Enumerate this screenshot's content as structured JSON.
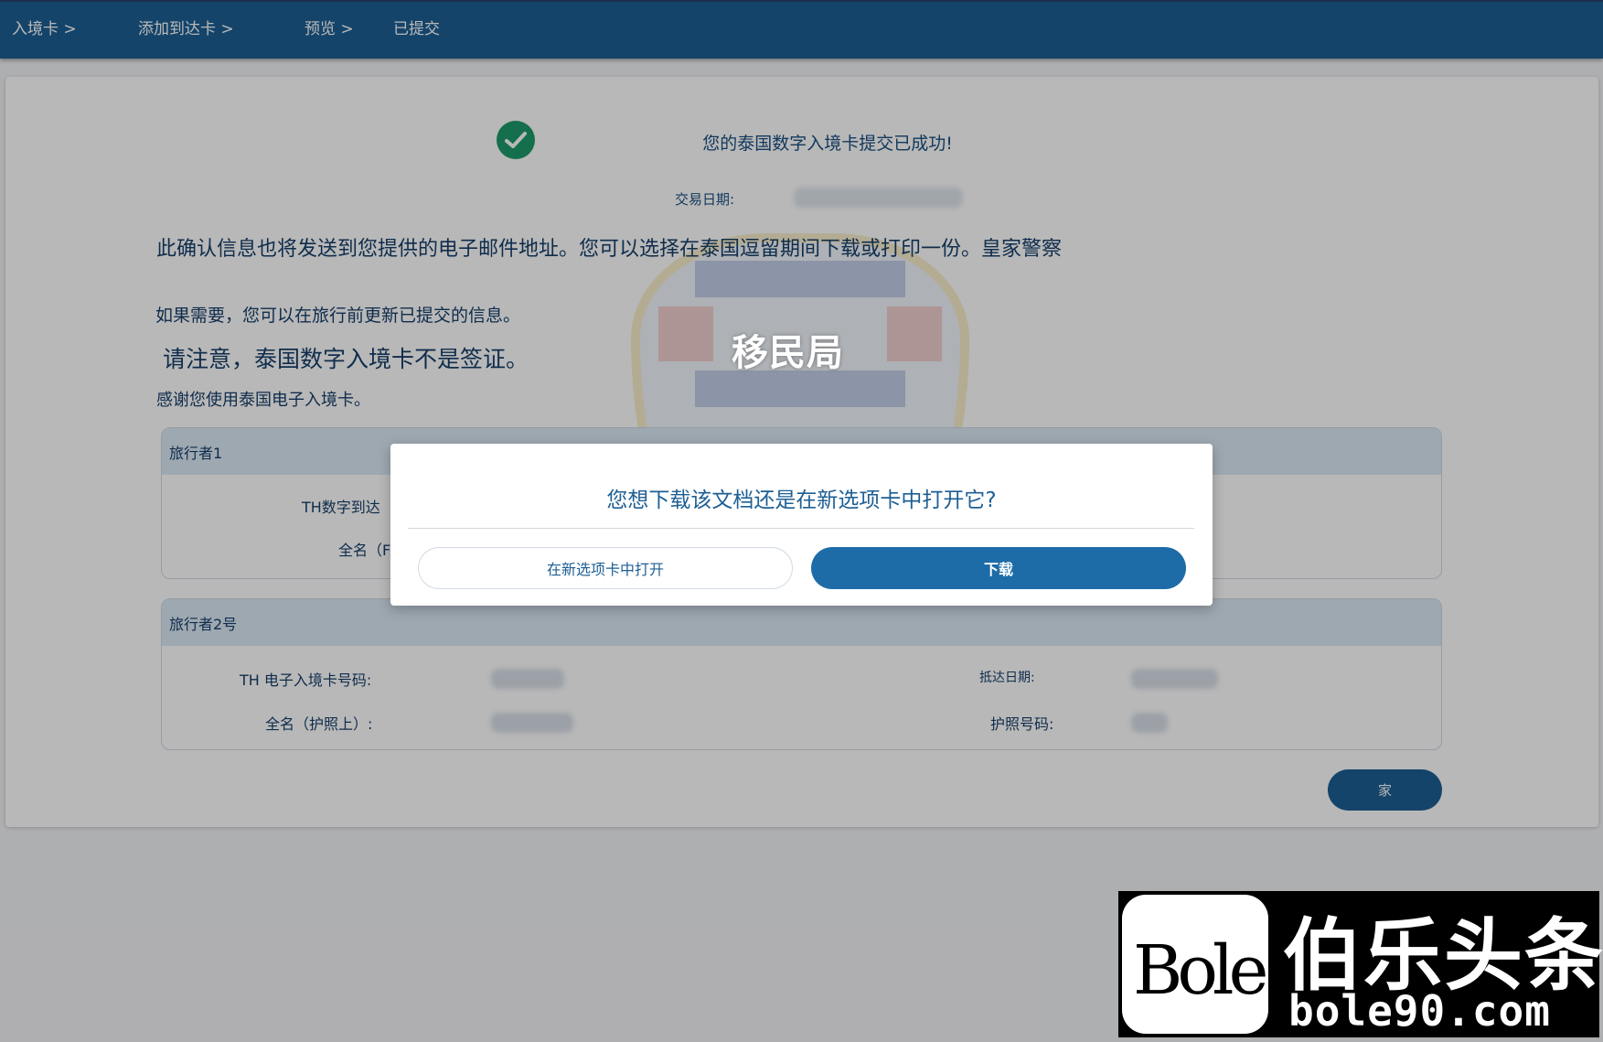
{
  "nav": {
    "steps": [
      "入境卡 >",
      "添加到达卡 >",
      "预览 >",
      "已提交"
    ]
  },
  "confirmation": {
    "title": "您的泰国数字入境卡提交已成功!",
    "transaction_label": "交易日期:",
    "message_email": "此确认信息也将发送到您提供的电子邮件地址。您可以选择在泰国逗留期间下载或打印一份。皇家警察",
    "message_update": "如果需要，您可以在旅行前更新已提交的信息。",
    "message_visa": "请注意，泰国数字入境卡不是签证。",
    "message_thanks": "感谢您使用泰国电子入境卡。",
    "overlay_text": "移民局"
  },
  "traveler1": {
    "heading": "旅行者1",
    "card_no_label": "TH数字到达",
    "full_name_label": "全名（F"
  },
  "traveler2": {
    "heading": "旅行者2号",
    "card_no_label": "TH 电子入境卡号码:",
    "full_name_label": "全名（护照上）:",
    "arrival_label": "抵达日期:",
    "passport_label": "护照号码:"
  },
  "home_button": "家",
  "modal": {
    "title": "您想下载该文档还是在新选项卡中打开它?",
    "open_label": "在新选项卡中打开",
    "download_label": "下载"
  },
  "watermark": {
    "logo_en": "Bole",
    "logo_cn": "伯乐头条",
    "url": "bole90.com"
  },
  "colors": {
    "nav": "#1d5f94",
    "success": "#1e9a6b",
    "primary": "#1d6ca8"
  }
}
